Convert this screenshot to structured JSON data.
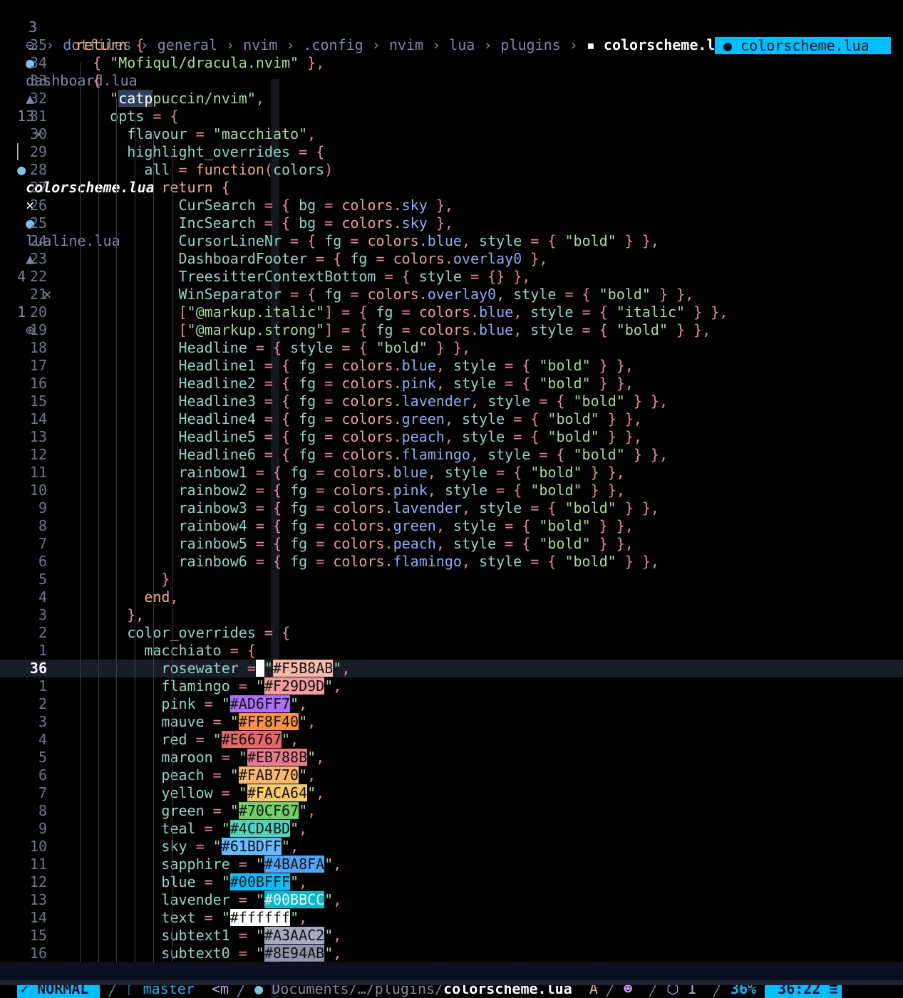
{
  "tabline": {
    "left_count": "3",
    "tabs": [
      {
        "name": "dashboard.lua",
        "warn": "13",
        "close": "×"
      },
      {
        "name": "colorscheme.lua",
        "close": "×"
      },
      {
        "name": "lualine.lua",
        "warn": "4",
        "close": "×"
      }
    ],
    "right_count": "1"
  },
  "breadcrumb": [
    "…",
    "dotfiles",
    "general",
    "nvim",
    ".config",
    "nvim",
    "lua",
    "plugins",
    "colorscheme.lua"
  ],
  "float_filename": "colorscheme.lua",
  "editor": {
    "cursor_line": "36",
    "lines": [
      {
        "n": "35",
        "t": "return {"
      },
      {
        "n": "34",
        "t": "  { \"Mofiqul/dracula.nvim\" },"
      },
      {
        "n": "33",
        "t": "  {"
      },
      {
        "n": "32",
        "t": "    \"catppuccin/nvim\","
      },
      {
        "n": "31",
        "t": "    opts = {"
      },
      {
        "n": "30",
        "t": "      flavour = \"macchiato\","
      },
      {
        "n": "29",
        "t": "      highlight_overrides = {"
      },
      {
        "n": "28",
        "t": "        all = function(colors)"
      },
      {
        "n": "27",
        "t": "          return {"
      },
      {
        "n": "26",
        "t": "            CurSearch = { bg = colors.sky },"
      },
      {
        "n": "25",
        "t": "            IncSearch = { bg = colors.sky },"
      },
      {
        "n": "24",
        "t": "            CursorLineNr = { fg = colors.blue, style = { \"bold\" } },"
      },
      {
        "n": "23",
        "t": "            DashboardFooter = { fg = colors.overlay0 },"
      },
      {
        "n": "22",
        "t": "            TreesitterContextBottom = { style = {} },"
      },
      {
        "n": "21",
        "t": "            WinSeparator = { fg = colors.overlay0, style = { \"bold\" } },"
      },
      {
        "n": "20",
        "t": "            [\"@markup.italic\"] = { fg = colors.blue, style = { \"italic\" } },"
      },
      {
        "n": "19",
        "t": "            [\"@markup.strong\"] = { fg = colors.blue, style = { \"bold\" } },"
      },
      {
        "n": "18",
        "t": "            Headline = { style = { \"bold\" } },"
      },
      {
        "n": "17",
        "t": "            Headline1 = { fg = colors.blue, style = { \"bold\" } },"
      },
      {
        "n": "16",
        "t": "            Headline2 = { fg = colors.pink, style = { \"bold\" } },"
      },
      {
        "n": "15",
        "t": "            Headline3 = { fg = colors.lavender, style = { \"bold\" } },"
      },
      {
        "n": "14",
        "t": "            Headline4 = { fg = colors.green, style = { \"bold\" } },"
      },
      {
        "n": "13",
        "t": "            Headline5 = { fg = colors.peach, style = { \"bold\" } },"
      },
      {
        "n": "12",
        "t": "            Headline6 = { fg = colors.flamingo, style = { \"bold\" } },"
      },
      {
        "n": "11",
        "t": "            rainbow1 = { fg = colors.blue, style = { \"bold\" } },"
      },
      {
        "n": "10",
        "t": "            rainbow2 = { fg = colors.pink, style = { \"bold\" } },"
      },
      {
        "n": "9",
        "t": "            rainbow3 = { fg = colors.lavender, style = { \"bold\" } },"
      },
      {
        "n": "8",
        "t": "            rainbow4 = { fg = colors.green, style = { \"bold\" } },"
      },
      {
        "n": "7",
        "t": "            rainbow5 = { fg = colors.peach, style = { \"bold\" } },"
      },
      {
        "n": "6",
        "t": "            rainbow6 = { fg = colors.flamingo, style = { \"bold\" } },"
      },
      {
        "n": "5",
        "t": "          }"
      },
      {
        "n": "4",
        "t": "        end,"
      },
      {
        "n": "3",
        "t": "      },"
      },
      {
        "n": "2",
        "t": "      color_overrides = {"
      },
      {
        "n": "1",
        "t": "        macchiato = {"
      }
    ],
    "palette": [
      {
        "n": "36",
        "name": "rosewater",
        "hex": "#F5B8AB"
      },
      {
        "n": "1",
        "name": "flamingo",
        "hex": "#F29D9D"
      },
      {
        "n": "2",
        "name": "pink",
        "hex": "#AD6FF7"
      },
      {
        "n": "3",
        "name": "mauve",
        "hex": "#FF8F40"
      },
      {
        "n": "4",
        "name": "red",
        "hex": "#E66767"
      },
      {
        "n": "5",
        "name": "maroon",
        "hex": "#EB788B"
      },
      {
        "n": "6",
        "name": "peach",
        "hex": "#FAB770"
      },
      {
        "n": "7",
        "name": "yellow",
        "hex": "#FACA64"
      },
      {
        "n": "8",
        "name": "green",
        "hex": "#70CF67"
      },
      {
        "n": "9",
        "name": "teal",
        "hex": "#4CD4BD"
      },
      {
        "n": "10",
        "name": "sky",
        "hex": "#61BDFF"
      },
      {
        "n": "11",
        "name": "sapphire",
        "hex": "#4BA8FA"
      },
      {
        "n": "12",
        "name": "blue",
        "hex": "#00BFFF"
      },
      {
        "n": "13",
        "name": "lavender",
        "hex": "#00BBCC"
      },
      {
        "n": "14",
        "name": "text",
        "hex": "#ffffff"
      },
      {
        "n": "15",
        "name": "subtext1",
        "hex": "#A3AAC2"
      },
      {
        "n": "16",
        "name": "subtext0",
        "hex": "#8E94AB"
      }
    ]
  },
  "statusline": {
    "mode": "NORMAL",
    "branch": "master",
    "macro": "<m",
    "path_dir": "Documents/…/plugins/",
    "path_file": "colorscheme.lua",
    "flag": "A",
    "lsp_count": "1",
    "percent": "36%",
    "position": "36:22"
  }
}
